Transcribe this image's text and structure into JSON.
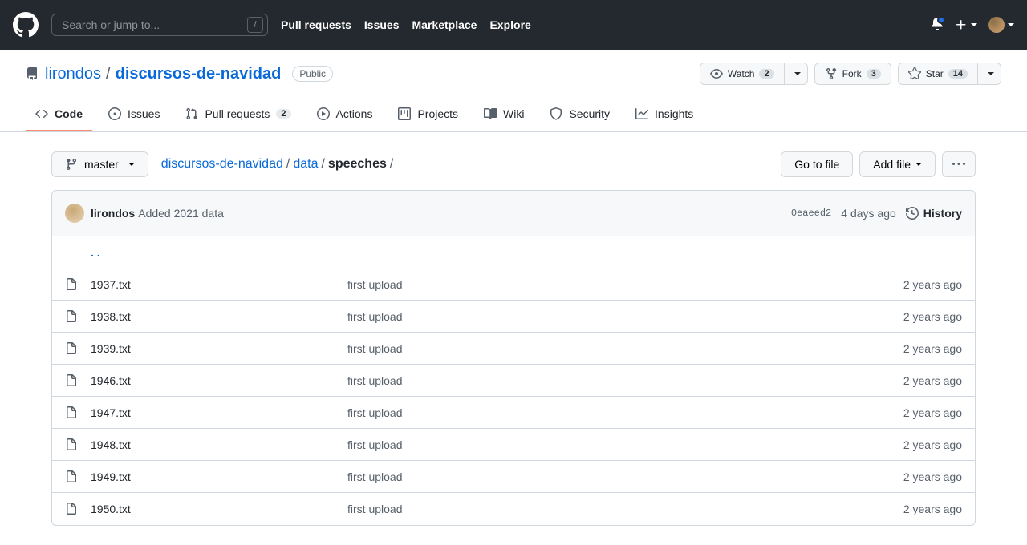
{
  "header": {
    "search_placeholder": "Search or jump to...",
    "slash": "/",
    "nav": {
      "pull_requests": "Pull requests",
      "issues": "Issues",
      "marketplace": "Marketplace",
      "explore": "Explore"
    }
  },
  "repo": {
    "owner": "lirondos",
    "separator": "/",
    "name": "discursos-de-navidad",
    "visibility": "Public",
    "watch": {
      "label": "Watch",
      "count": "2"
    },
    "fork": {
      "label": "Fork",
      "count": "3"
    },
    "star": {
      "label": "Star",
      "count": "14"
    }
  },
  "tabs": {
    "code": "Code",
    "issues": "Issues",
    "pull_requests": "Pull requests",
    "pr_count": "2",
    "actions": "Actions",
    "projects": "Projects",
    "wiki": "Wiki",
    "security": "Security",
    "insights": "Insights"
  },
  "filenav": {
    "branch": "master",
    "crumb_repo": "discursos-de-navidad",
    "crumb_data": "data",
    "crumb_current": "speeches",
    "sep": "/",
    "go_to_file": "Go to file",
    "add_file": "Add file"
  },
  "commit": {
    "author": "lirondos",
    "message": "Added 2021 data",
    "sha": "0eaeed2",
    "time": "4 days ago",
    "history": "History",
    "parent": ". ."
  },
  "files": [
    {
      "name": "1937.txt",
      "msg": "first upload",
      "time": "2 years ago"
    },
    {
      "name": "1938.txt",
      "msg": "first upload",
      "time": "2 years ago"
    },
    {
      "name": "1939.txt",
      "msg": "first upload",
      "time": "2 years ago"
    },
    {
      "name": "1946.txt",
      "msg": "first upload",
      "time": "2 years ago"
    },
    {
      "name": "1947.txt",
      "msg": "first upload",
      "time": "2 years ago"
    },
    {
      "name": "1948.txt",
      "msg": "first upload",
      "time": "2 years ago"
    },
    {
      "name": "1949.txt",
      "msg": "first upload",
      "time": "2 years ago"
    },
    {
      "name": "1950.txt",
      "msg": "first upload",
      "time": "2 years ago"
    }
  ]
}
